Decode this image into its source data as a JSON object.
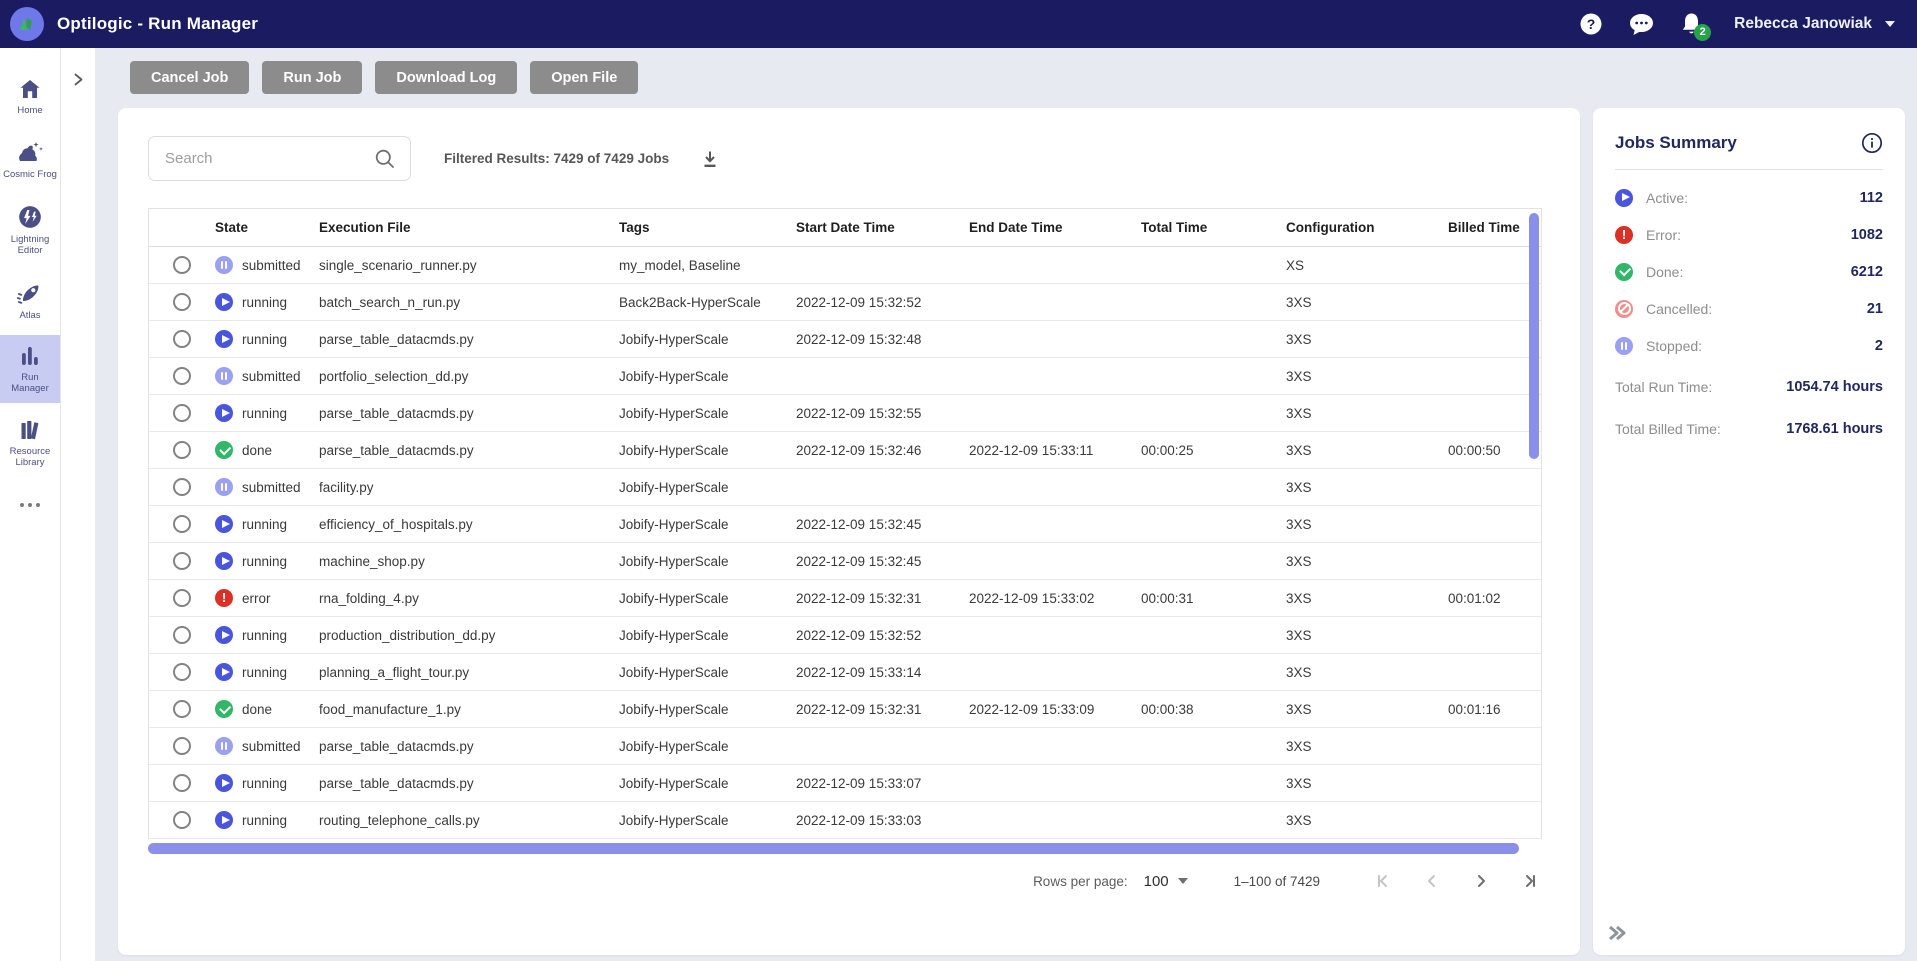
{
  "topbar": {
    "title": "Optilogic - Run Manager",
    "user": "Rebecca Janowiak",
    "notification_count": "2"
  },
  "sidebar": {
    "items": [
      {
        "label": "Home"
      },
      {
        "label": "Cosmic Frog"
      },
      {
        "label": "Lightning Editor"
      },
      {
        "label": "Atlas"
      },
      {
        "label": "Run Manager",
        "active": true
      },
      {
        "label": "Resource Library"
      }
    ]
  },
  "toolbar": {
    "buttons": [
      "Cancel Job",
      "Run Job",
      "Download Log",
      "Open File"
    ]
  },
  "search": {
    "placeholder": "Search"
  },
  "filter_summary": "Filtered Results: 7429 of 7429 Jobs",
  "table": {
    "columns": [
      "State",
      "Execution File",
      "Tags",
      "Start Date Time",
      "End Date Time",
      "Total Time",
      "Configuration",
      "Billed Time"
    ],
    "rows": [
      {
        "state": "submitted",
        "file": "single_scenario_runner.py",
        "tags": "my_model, Baseline",
        "start": "",
        "end": "",
        "total": "",
        "config": "XS",
        "billed": ""
      },
      {
        "state": "running",
        "file": "batch_search_n_run.py",
        "tags": "Back2Back-HyperScale",
        "start": "2022-12-09 15:32:52",
        "end": "",
        "total": "",
        "config": "3XS",
        "billed": ""
      },
      {
        "state": "running",
        "file": "parse_table_datacmds.py",
        "tags": "Jobify-HyperScale",
        "start": "2022-12-09 15:32:48",
        "end": "",
        "total": "",
        "config": "3XS",
        "billed": ""
      },
      {
        "state": "submitted",
        "file": "portfolio_selection_dd.py",
        "tags": "Jobify-HyperScale",
        "start": "",
        "end": "",
        "total": "",
        "config": "3XS",
        "billed": ""
      },
      {
        "state": "running",
        "file": "parse_table_datacmds.py",
        "tags": "Jobify-HyperScale",
        "start": "2022-12-09 15:32:55",
        "end": "",
        "total": "",
        "config": "3XS",
        "billed": ""
      },
      {
        "state": "done",
        "file": "parse_table_datacmds.py",
        "tags": "Jobify-HyperScale",
        "start": "2022-12-09 15:32:46",
        "end": "2022-12-09 15:33:11",
        "total": "00:00:25",
        "config": "3XS",
        "billed": "00:00:50"
      },
      {
        "state": "submitted",
        "file": "facility.py",
        "tags": "Jobify-HyperScale",
        "start": "",
        "end": "",
        "total": "",
        "config": "3XS",
        "billed": ""
      },
      {
        "state": "running",
        "file": "efficiency_of_hospitals.py",
        "tags": "Jobify-HyperScale",
        "start": "2022-12-09 15:32:45",
        "end": "",
        "total": "",
        "config": "3XS",
        "billed": ""
      },
      {
        "state": "running",
        "file": "machine_shop.py",
        "tags": "Jobify-HyperScale",
        "start": "2022-12-09 15:32:45",
        "end": "",
        "total": "",
        "config": "3XS",
        "billed": ""
      },
      {
        "state": "error",
        "file": "rna_folding_4.py",
        "tags": "Jobify-HyperScale",
        "start": "2022-12-09 15:32:31",
        "end": "2022-12-09 15:33:02",
        "total": "00:00:31",
        "config": "3XS",
        "billed": "00:01:02"
      },
      {
        "state": "running",
        "file": "production_distribution_dd.py",
        "tags": "Jobify-HyperScale",
        "start": "2022-12-09 15:32:52",
        "end": "",
        "total": "",
        "config": "3XS",
        "billed": ""
      },
      {
        "state": "running",
        "file": "planning_a_flight_tour.py",
        "tags": "Jobify-HyperScale",
        "start": "2022-12-09 15:33:14",
        "end": "",
        "total": "",
        "config": "3XS",
        "billed": ""
      },
      {
        "state": "done",
        "file": "food_manufacture_1.py",
        "tags": "Jobify-HyperScale",
        "start": "2022-12-09 15:32:31",
        "end": "2022-12-09 15:33:09",
        "total": "00:00:38",
        "config": "3XS",
        "billed": "00:01:16"
      },
      {
        "state": "submitted",
        "file": "parse_table_datacmds.py",
        "tags": "Jobify-HyperScale",
        "start": "",
        "end": "",
        "total": "",
        "config": "3XS",
        "billed": ""
      },
      {
        "state": "running",
        "file": "parse_table_datacmds.py",
        "tags": "Jobify-HyperScale",
        "start": "2022-12-09 15:33:07",
        "end": "",
        "total": "",
        "config": "3XS",
        "billed": ""
      },
      {
        "state": "running",
        "file": "routing_telephone_calls.py",
        "tags": "Jobify-HyperScale",
        "start": "2022-12-09 15:33:03",
        "end": "",
        "total": "",
        "config": "3XS",
        "billed": ""
      }
    ]
  },
  "pagination": {
    "rows_per_page_label": "Rows per page:",
    "rows_per_page": "100",
    "range": "1–100 of 7429"
  },
  "summary": {
    "title": "Jobs Summary",
    "items": [
      {
        "label": "Active:",
        "value": "112",
        "state": "active"
      },
      {
        "label": "Error:",
        "value": "1082",
        "state": "error"
      },
      {
        "label": "Done:",
        "value": "6212",
        "state": "done"
      },
      {
        "label": "Cancelled:",
        "value": "21",
        "state": "cancelled"
      },
      {
        "label": "Stopped:",
        "value": "2",
        "state": "stopped"
      }
    ],
    "totals": [
      {
        "label": "Total Run Time:",
        "value": "1054.74 hours"
      },
      {
        "label": "Total Billed Time:",
        "value": "1768.61 hours"
      }
    ]
  },
  "colors": {
    "topbar": "#1b1b62",
    "running": "#4a55dd",
    "submitted": "#9ba0f0",
    "done": "#32b768",
    "error": "#da3025",
    "cancelled": "#f08d8d",
    "stopped": "#9ba0f0",
    "scrollbar": "#8a90e9",
    "sidebar_active": "#c8ccf2",
    "badge": "#27a34b"
  }
}
